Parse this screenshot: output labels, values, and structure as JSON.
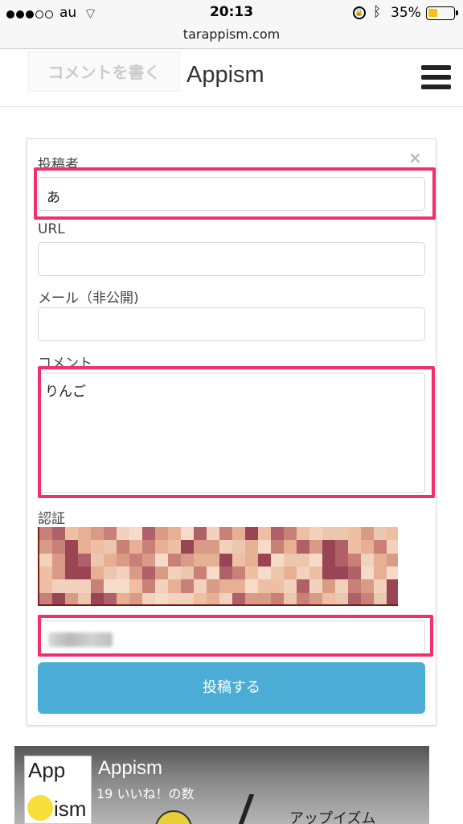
{
  "status_bar": {
    "carrier": "au",
    "time": "20:13",
    "battery_percent": "35%"
  },
  "browser": {
    "url": "tarappism.com"
  },
  "header": {
    "write_comment_label": "コメントを書く",
    "site_title": "Appism"
  },
  "form": {
    "author_label": "投稿者",
    "author_value": "あ",
    "url_label": "URL",
    "url_value": "",
    "email_label": "メール（非公開)",
    "email_value": "",
    "comment_label": "コメント",
    "comment_value": "りんご",
    "captcha_label": "認証",
    "submit_label": "投稿する",
    "close_symbol": "×"
  },
  "colors": {
    "highlight": "#f0306e",
    "submit_button": "#4badd5"
  },
  "facebook_card": {
    "logo_top": "App",
    "logo_bottom": "ism",
    "page_name": "Appism",
    "likes_text": "19 いいね！の数",
    "subtitle": "アップイズム"
  }
}
